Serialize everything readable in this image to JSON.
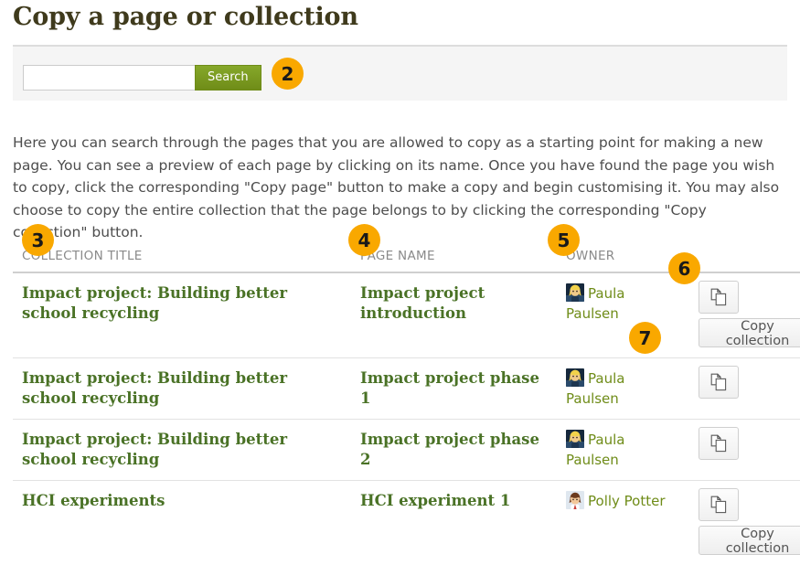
{
  "page": {
    "title": "Copy a page or collection",
    "description": "Here you can search through the pages that you are allowed to copy as a starting point for making a new page. You can see a preview of each page by clicking on its name. Once you have found the page you wish to copy, click the corresponding \"Copy page\" button to make a copy and begin customising it. You may also choose to copy the entire collection that the page belongs to by clicking the corresponding \"Copy collection\" button."
  },
  "search": {
    "value": "",
    "placeholder": "",
    "button_label": "Search"
  },
  "table": {
    "headers": {
      "collection": "COLLECTION TITLE",
      "page": "PAGE NAME",
      "owner": "OWNER",
      "actions": ""
    },
    "rows": [
      {
        "collection": "Impact project: Building better school recycling",
        "page": "Impact project introduction",
        "owner": "Paula Paulsen",
        "avatar": "avatar-paula",
        "copy_page_label": "Copy page",
        "copy_collection_label": "Copy collection",
        "has_copy_collection": true
      },
      {
        "collection": "Impact project: Building better school recycling",
        "page": "Impact project phase 1",
        "owner": "Paula Paulsen",
        "avatar": "avatar-paula",
        "copy_page_label": "Copy page",
        "copy_collection_label": "",
        "has_copy_collection": false
      },
      {
        "collection": "Impact project: Building better school recycling",
        "page": "Impact project phase 2",
        "owner": "Paula Paulsen",
        "avatar": "avatar-paula",
        "copy_page_label": "Copy page",
        "copy_collection_label": "",
        "has_copy_collection": false
      },
      {
        "collection": "HCI experiments",
        "page": "HCI experiment 1",
        "owner": "Polly Potter",
        "avatar": "avatar-polly",
        "copy_page_label": "Copy page",
        "copy_collection_label": "Copy collection",
        "has_copy_collection": true
      }
    ]
  },
  "badges": {
    "b2": "2",
    "b3": "3",
    "b4": "4",
    "b5": "5",
    "b6": "6",
    "b7": "7"
  },
  "colors": {
    "badge_orange": "#f9a800",
    "search_green": "#6f8c18",
    "link_green": "#4a7226",
    "title_brown": "#3f3a1c",
    "panel_gray": "#f5f5f5"
  },
  "icons": {
    "copy_pages": "copy-pages-icon"
  }
}
